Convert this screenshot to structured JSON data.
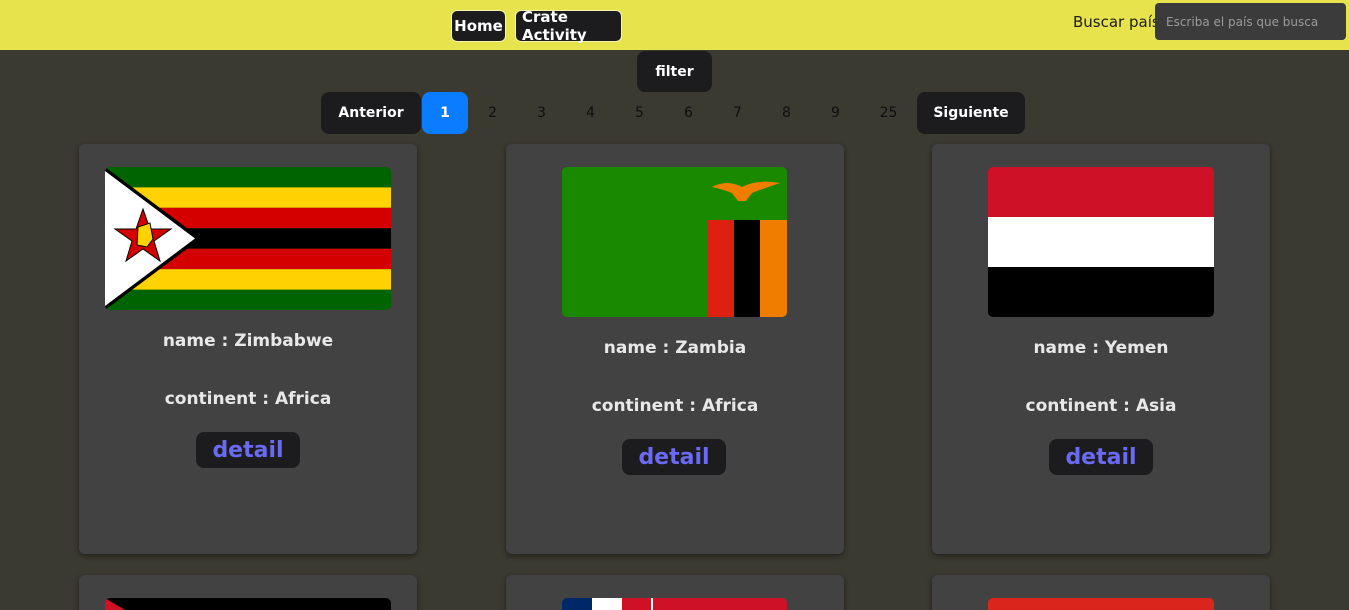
{
  "nav": {
    "home_label": "Home",
    "activity_label": "Crate Activity",
    "search_label": "Buscar país:",
    "search_placeholder": "Escriba el país que busca",
    "search_value": ""
  },
  "filter_label": "filter",
  "pagination": {
    "prev_label": "Anterior",
    "next_label": "Siguiente",
    "pages": [
      "1",
      "2",
      "3",
      "4",
      "5",
      "6",
      "7",
      "8",
      "9",
      "25"
    ],
    "current_page": "1"
  },
  "cards": [
    {
      "name_text": "name : Zimbabwe",
      "continent_text": "continent : Africa",
      "detail_label": "detail",
      "flag_icon": "zimbabwe-flag"
    },
    {
      "name_text": "name : Zambia",
      "continent_text": "continent : Africa",
      "detail_label": "detail",
      "flag_icon": "zambia-flag"
    },
    {
      "name_text": "name : Yemen",
      "continent_text": "continent : Asia",
      "detail_label": "detail",
      "flag_icon": "yemen-flag"
    }
  ],
  "colors": {
    "topbar": "#e7e34d",
    "background": "#3b3a31",
    "card": "#424242",
    "button_dark": "#1c1b1d",
    "active_page": "#0a7cff",
    "detail_text": "#6a6af2"
  }
}
